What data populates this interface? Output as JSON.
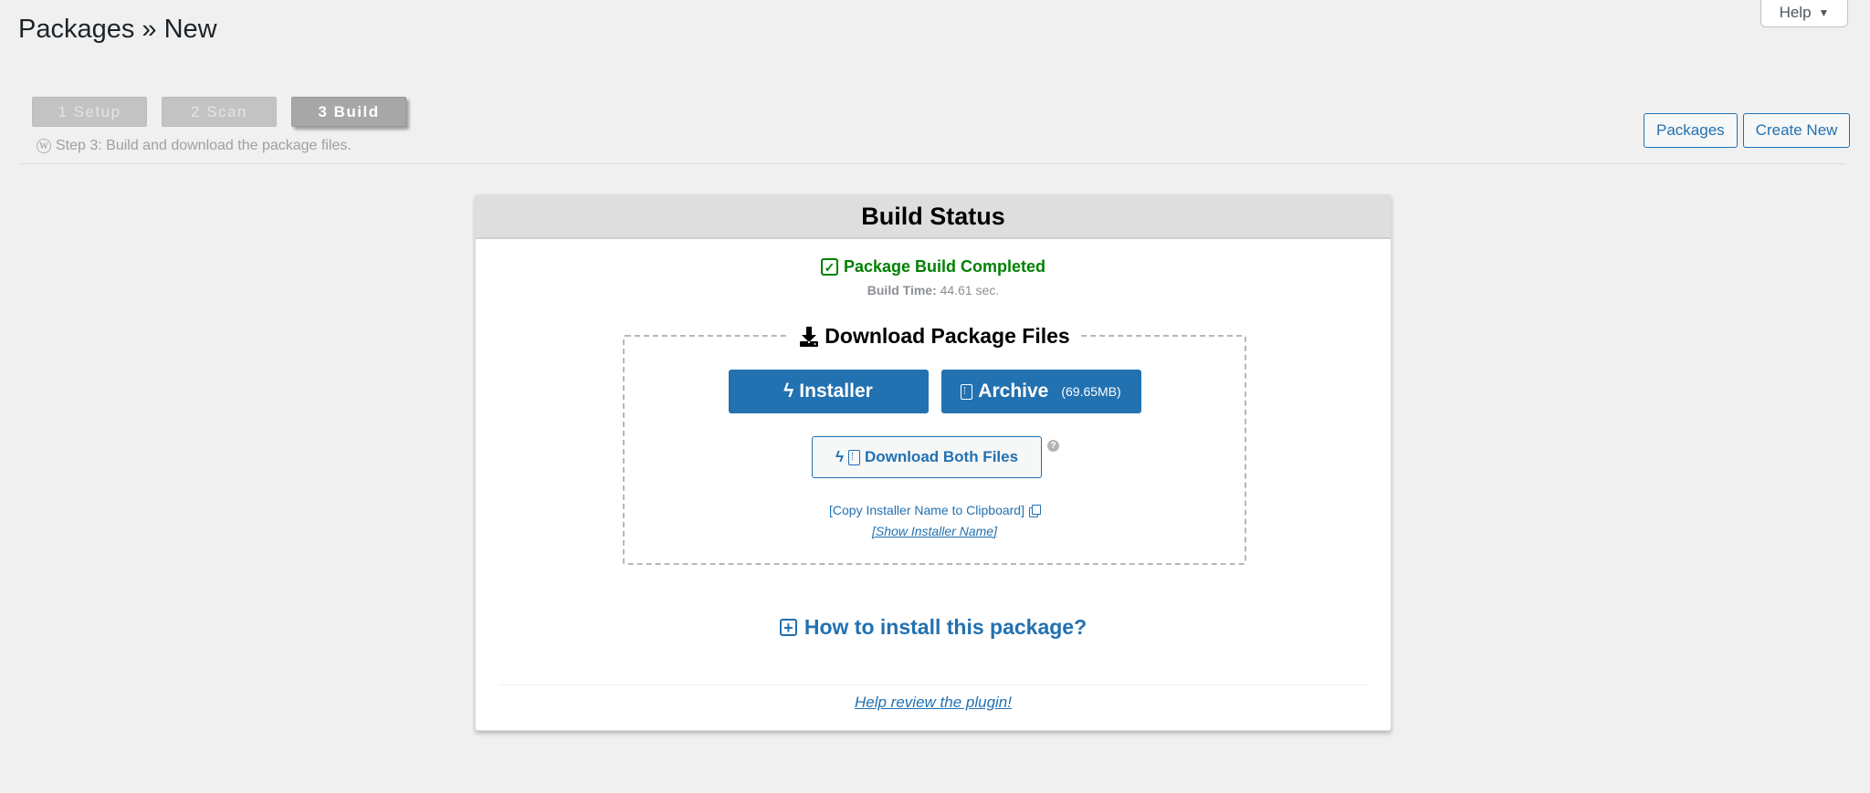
{
  "header": {
    "title": "Packages » New",
    "help_label": "Help",
    "help_caret": "▼"
  },
  "steps": [
    {
      "label": "1 Setup",
      "active": false
    },
    {
      "label": "2 Scan",
      "active": false
    },
    {
      "label": "3 Build",
      "active": true
    }
  ],
  "step_description": "Step 3: Build and download the package files.",
  "top_actions": {
    "packages_label": "Packages",
    "create_new_label": "Create New"
  },
  "panel": {
    "title": "Build Status",
    "status": "Package Build Completed",
    "build_time_label": "Build Time:",
    "build_time_value": "44.61 sec.",
    "download": {
      "legend": "Download Package Files",
      "installer_label": "Installer",
      "archive_label": "Archive",
      "archive_size": "(69.65MB)",
      "download_both_label": "Download Both Files",
      "copy_installer_label": "[Copy Installer Name to Clipboard]",
      "show_installer_label": "[Show Installer Name]"
    },
    "howto_label": "How to install this package?",
    "review_label": "Help review the plugin!"
  },
  "colors": {
    "accent": "#2271b1",
    "success": "#008000",
    "background": "#f0f0f1"
  },
  "icons": {
    "bolt": "bolt-icon",
    "file_archive": "file-archive-icon",
    "download": "download-icon",
    "check": "check-square-icon",
    "copy": "copy-icon",
    "question": "question-circle-icon",
    "plus": "plus-square-icon",
    "wordpress": "wordpress-icon"
  }
}
